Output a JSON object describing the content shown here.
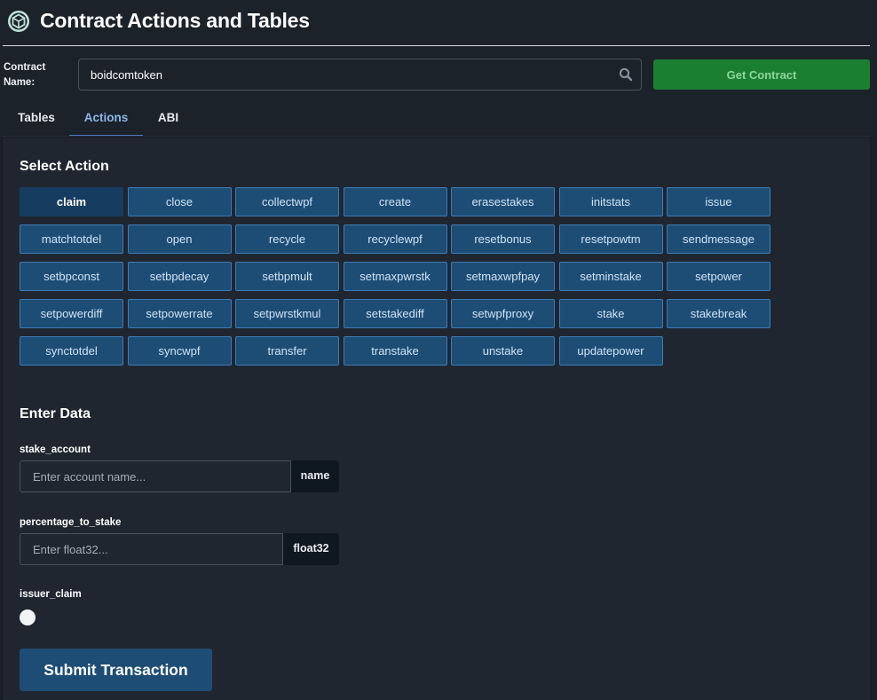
{
  "header": {
    "title": "Contract Actions and Tables",
    "logo_icon": "boid-logo-icon"
  },
  "contract": {
    "label": "Contract Name:",
    "value": "boidcomtoken",
    "search_icon": "search-icon",
    "get_button": "Get Contract"
  },
  "tabs": [
    {
      "label": "Tables",
      "active": false
    },
    {
      "label": "Actions",
      "active": true
    },
    {
      "label": "ABI",
      "active": false
    }
  ],
  "actions": {
    "title": "Select Action",
    "selected": "claim",
    "items": [
      "claim",
      "close",
      "collectwpf",
      "create",
      "erasestakes",
      "initstats",
      "issue",
      "matchtotdel",
      "open",
      "recycle",
      "recyclewpf",
      "resetbonus",
      "resetpowtm",
      "sendmessage",
      "setbpconst",
      "setbpdecay",
      "setbpmult",
      "setmaxpwrstk",
      "setmaxwpfpay",
      "setminstake",
      "setpower",
      "setpowerdiff",
      "setpowerrate",
      "setpwrstkmul",
      "setstakediff",
      "setwpfproxy",
      "stake",
      "stakebreak",
      "synctotdel",
      "syncwpf",
      "transfer",
      "transtake",
      "unstake",
      "updatepower"
    ]
  },
  "form": {
    "title": "Enter Data",
    "fields": [
      {
        "label": "stake_account",
        "placeholder": "Enter account name...",
        "type": "name"
      },
      {
        "label": "percentage_to_stake",
        "placeholder": "Enter float32...",
        "type": "float32"
      },
      {
        "label": "issuer_claim",
        "kind": "toggle",
        "checked": false
      }
    ],
    "submit_label": "Submit Transaction"
  },
  "colors": {
    "background": "#1c222a",
    "panel": "#1f2630",
    "action_button": "#1d4d75",
    "action_border": "#3d7bb4",
    "selected_action": "#163d5f",
    "get_contract": "#1b7f31",
    "active_tab": "#8bb8e8"
  }
}
